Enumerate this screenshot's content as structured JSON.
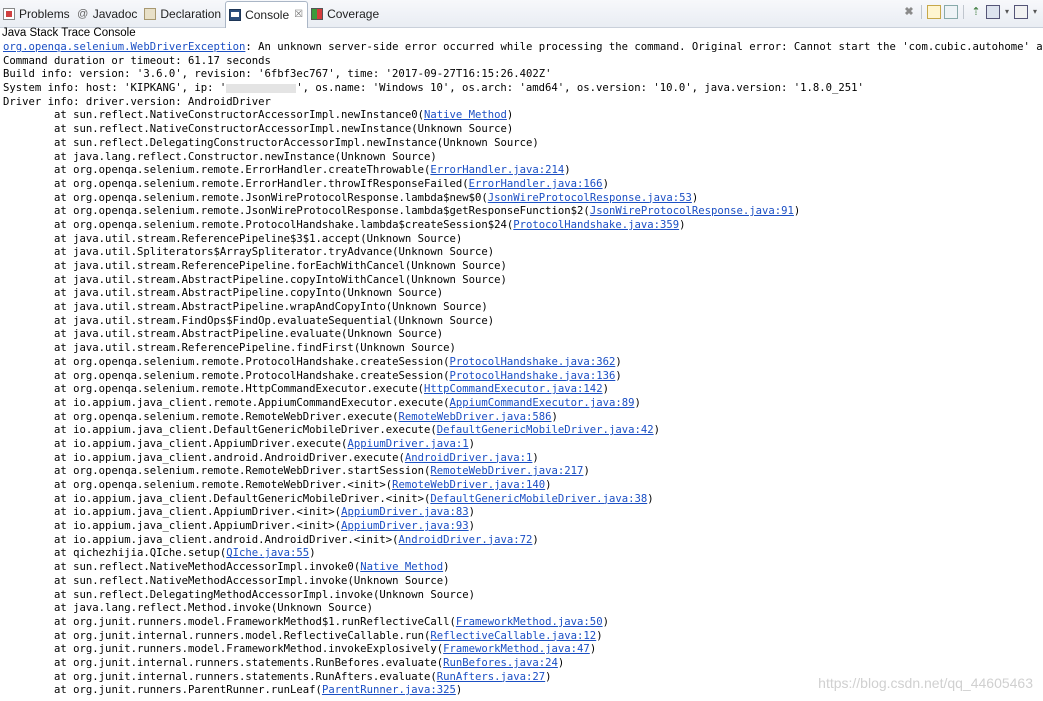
{
  "tabs": [
    {
      "label": "Problems",
      "icon": "problems-icon"
    },
    {
      "label": "Javadoc",
      "icon": "javadoc-icon"
    },
    {
      "label": "Declaration",
      "icon": "declaration-icon"
    },
    {
      "label": "Console",
      "icon": "console-icon",
      "active": true,
      "close": "☒"
    },
    {
      "label": "Coverage",
      "icon": "coverage-icon"
    }
  ],
  "toolbar": {
    "terminate": "✖",
    "pin": "⇡",
    "menu": "▾"
  },
  "console": {
    "title": "Java Stack Trace Console",
    "header": [
      {
        "pre": "",
        "link": "org.openqa.selenium.WebDriverException",
        "post": ": An unknown server-side error occurred while processing the command. Original error: Cannot start the 'com.cubic.autohome' applica"
      },
      {
        "pre": "Command duration or timeout: 61.17 seconds",
        "link": "",
        "post": ""
      },
      {
        "pre": "Build info: version: '3.6.0', revision: '6fbf3ec767', time: '2017-09-27T16:15:26.402Z'",
        "link": "",
        "post": ""
      },
      {
        "pre": "System info: host: 'KIPKANG', ip: '",
        "redact": true,
        "post": "', os.name: 'Windows 10', os.arch: 'amd64', os.version: '10.0', java.version: '1.8.0_251'"
      },
      {
        "pre": "Driver info: driver.version: AndroidDriver",
        "link": "",
        "post": ""
      }
    ],
    "frames": [
      {
        "method": "sun.reflect.NativeConstructorAccessorImpl.newInstance0",
        "src": "Native Method",
        "link": true
      },
      {
        "method": "sun.reflect.NativeConstructorAccessorImpl.newInstance",
        "src": "Unknown Source",
        "link": false
      },
      {
        "method": "sun.reflect.DelegatingConstructorAccessorImpl.newInstance",
        "src": "Unknown Source",
        "link": false
      },
      {
        "method": "java.lang.reflect.Constructor.newInstance",
        "src": "Unknown Source",
        "link": false
      },
      {
        "method": "org.openqa.selenium.remote.ErrorHandler.createThrowable",
        "src": "ErrorHandler.java:214",
        "link": true
      },
      {
        "method": "org.openqa.selenium.remote.ErrorHandler.throwIfResponseFailed",
        "src": "ErrorHandler.java:166",
        "link": true
      },
      {
        "method": "org.openqa.selenium.remote.JsonWireProtocolResponse.lambda$new$0",
        "src": "JsonWireProtocolResponse.java:53",
        "link": true
      },
      {
        "method": "org.openqa.selenium.remote.JsonWireProtocolResponse.lambda$getResponseFunction$2",
        "src": "JsonWireProtocolResponse.java:91",
        "link": true
      },
      {
        "method": "org.openqa.selenium.remote.ProtocolHandshake.lambda$createSession$24",
        "src": "ProtocolHandshake.java:359",
        "link": true
      },
      {
        "method": "java.util.stream.ReferencePipeline$3$1.accept",
        "src": "Unknown Source",
        "link": false
      },
      {
        "method": "java.util.Spliterators$ArraySpliterator.tryAdvance",
        "src": "Unknown Source",
        "link": false
      },
      {
        "method": "java.util.stream.ReferencePipeline.forEachWithCancel",
        "src": "Unknown Source",
        "link": false
      },
      {
        "method": "java.util.stream.AbstractPipeline.copyIntoWithCancel",
        "src": "Unknown Source",
        "link": false
      },
      {
        "method": "java.util.stream.AbstractPipeline.copyInto",
        "src": "Unknown Source",
        "link": false
      },
      {
        "method": "java.util.stream.AbstractPipeline.wrapAndCopyInto",
        "src": "Unknown Source",
        "link": false
      },
      {
        "method": "java.util.stream.FindOps$FindOp.evaluateSequential",
        "src": "Unknown Source",
        "link": false
      },
      {
        "method": "java.util.stream.AbstractPipeline.evaluate",
        "src": "Unknown Source",
        "link": false
      },
      {
        "method": "java.util.stream.ReferencePipeline.findFirst",
        "src": "Unknown Source",
        "link": false
      },
      {
        "method": "org.openqa.selenium.remote.ProtocolHandshake.createSession",
        "src": "ProtocolHandshake.java:362",
        "link": true
      },
      {
        "method": "org.openqa.selenium.remote.ProtocolHandshake.createSession",
        "src": "ProtocolHandshake.java:136",
        "link": true
      },
      {
        "method": "org.openqa.selenium.remote.HttpCommandExecutor.execute",
        "src": "HttpCommandExecutor.java:142",
        "link": true
      },
      {
        "method": "io.appium.java_client.remote.AppiumCommandExecutor.execute",
        "src": "AppiumCommandExecutor.java:89",
        "link": true
      },
      {
        "method": "org.openqa.selenium.remote.RemoteWebDriver.execute",
        "src": "RemoteWebDriver.java:586",
        "link": true
      },
      {
        "method": "io.appium.java_client.DefaultGenericMobileDriver.execute",
        "src": "DefaultGenericMobileDriver.java:42",
        "link": true
      },
      {
        "method": "io.appium.java_client.AppiumDriver.execute",
        "src": "AppiumDriver.java:1",
        "link": true
      },
      {
        "method": "io.appium.java_client.android.AndroidDriver.execute",
        "src": "AndroidDriver.java:1",
        "link": true
      },
      {
        "method": "org.openqa.selenium.remote.RemoteWebDriver.startSession",
        "src": "RemoteWebDriver.java:217",
        "link": true
      },
      {
        "method": "org.openqa.selenium.remote.RemoteWebDriver.<init>",
        "src": "RemoteWebDriver.java:140",
        "link": true
      },
      {
        "method": "io.appium.java_client.DefaultGenericMobileDriver.<init>",
        "src": "DefaultGenericMobileDriver.java:38",
        "link": true
      },
      {
        "method": "io.appium.java_client.AppiumDriver.<init>",
        "src": "AppiumDriver.java:83",
        "link": true
      },
      {
        "method": "io.appium.java_client.AppiumDriver.<init>",
        "src": "AppiumDriver.java:93",
        "link": true
      },
      {
        "method": "io.appium.java_client.android.AndroidDriver.<init>",
        "src": "AndroidDriver.java:72",
        "link": true
      },
      {
        "method": "qichezhijia.QIche.setup",
        "src": "QIche.java:55",
        "link": true
      },
      {
        "method": "sun.reflect.NativeMethodAccessorImpl.invoke0",
        "src": "Native Method",
        "link": true
      },
      {
        "method": "sun.reflect.NativeMethodAccessorImpl.invoke",
        "src": "Unknown Source",
        "link": false
      },
      {
        "method": "sun.reflect.DelegatingMethodAccessorImpl.invoke",
        "src": "Unknown Source",
        "link": false
      },
      {
        "method": "java.lang.reflect.Method.invoke",
        "src": "Unknown Source",
        "link": false
      },
      {
        "method": "org.junit.runners.model.FrameworkMethod$1.runReflectiveCall",
        "src": "FrameworkMethod.java:50",
        "link": true
      },
      {
        "method": "org.junit.internal.runners.model.ReflectiveCallable.run",
        "src": "ReflectiveCallable.java:12",
        "link": true
      },
      {
        "method": "org.junit.runners.model.FrameworkMethod.invokeExplosively",
        "src": "FrameworkMethod.java:47",
        "link": true
      },
      {
        "method": "org.junit.internal.runners.statements.RunBefores.evaluate",
        "src": "RunBefores.java:24",
        "link": true
      },
      {
        "method": "org.junit.internal.runners.statements.RunAfters.evaluate",
        "src": "RunAfters.java:27",
        "link": true
      },
      {
        "method": "org.junit.runners.ParentRunner.runLeaf",
        "src": "ParentRunner.java:325",
        "link": true
      }
    ]
  },
  "watermark": "https://blog.csdn.net/qq_44605463"
}
